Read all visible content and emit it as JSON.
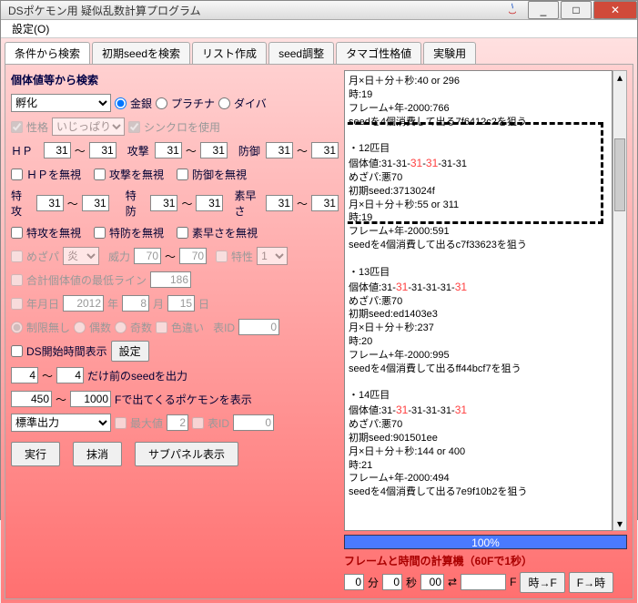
{
  "window": {
    "title": "DSポケモン用 疑似乱数計算プログラム"
  },
  "menu": {
    "settings": "設定(O)"
  },
  "tabs": [
    "条件から検索",
    "初期seedを検索",
    "リスト作成",
    "seed調整",
    "タマゴ性格値",
    "実験用"
  ],
  "active_tab": 0,
  "left": {
    "heading": "個体値等から検索",
    "method_select": "孵化",
    "version": {
      "gold": "金銀",
      "plat": "プラチナ",
      "dia": "ダイバ"
    },
    "nature_chk": "性格",
    "nature_val": "いじっぱり",
    "synchro": "シンクロを使用",
    "stats": {
      "hp": {
        "l": "ＨＰ",
        "a": "31",
        "b": "31"
      },
      "atk": {
        "l": "攻撃",
        "a": "31",
        "b": "31"
      },
      "def": {
        "l": "防御",
        "a": "31",
        "b": "31"
      },
      "spa": {
        "l": "特攻",
        "a": "31",
        "b": "31"
      },
      "spd": {
        "l": "特防",
        "a": "31",
        "b": "31"
      },
      "spe": {
        "l": "素早さ",
        "a": "31",
        "b": "31"
      }
    },
    "ignore": {
      "hp": "ＨＰを無視",
      "atk": "攻撃を無視",
      "def": "防御を無視",
      "spa": "特攻を無視",
      "spd": "特防を無視",
      "spe": "素早さを無視"
    },
    "hidden": {
      "l": "めざパ",
      "type": "炎",
      "power_l": "威力",
      "p1": "70",
      "p2": "70",
      "ability_l": "特性",
      "a": "1"
    },
    "total_min": {
      "l": "合計個体値の最低ライン",
      "v": "186"
    },
    "date": {
      "l": "年月日",
      "y": "2012",
      "yl": "年",
      "m": "8",
      "ml": "月",
      "d": "15",
      "dl": "日"
    },
    "limit": {
      "none": "制限無し",
      "even": "偶数",
      "odd": "奇数",
      "color": "色違い",
      "id_l": "表ID",
      "id": "0"
    },
    "ds_start": {
      "l": "DS開始時間表示",
      "btn": "設定"
    },
    "seed_before": {
      "a": "4",
      "b": "4",
      "l": "だけ前のseedを出力"
    },
    "frame_range": {
      "a": "450",
      "b": "1000",
      "l": "Fで出てくるポケモンを表示"
    },
    "output": "標準出力",
    "max": {
      "l": "最大値",
      "v": "2",
      "id_l": "表ID",
      "id": "0"
    },
    "buttons": {
      "run": "実行",
      "clear": "抹消",
      "sub": "サブパネル表示"
    }
  },
  "results_text": "月×日＋分＋秒:40 or 296\n時:19\nフレーム+年-2000:766\nseedを4個消費して出る7f6412c2を狙う\n\n・12匹目\n個体値:31-31-<hl>31</hl>-<hl>31</hl>-31-31\nめざパ:悪70\n初期seed:3713024f\n月×日＋分＋秒:55 or 311\n時:19\nフレーム+年-2000:591\nseedを4個消費して出るc7f33623を狙う\n\n・13匹目\n個体値:31-<hl>31</hl>-31-31-31-<hl>31</hl>\nめざパ:悪70\n初期seed:ed1403e3\n月×日＋分＋秒:237\n時:20\nフレーム+年-2000:995\nseedを4個消費して出るff44bcf7を狙う\n\n・14匹目\n個体値:31-<hl>31</hl>-31-31-31-<hl>31</hl>\nめざパ:悪70\n初期seed:901501ee\n月×日＋分＋秒:144 or 400\n時:21\nフレーム+年-2000:494\nseedを4個消費して出る7e9f10b2を狙う",
  "progress": "100%",
  "footer": {
    "title": "フレームと時間の計算機（60Fで1秒）",
    "min_l": "分",
    "sec_l": "秒",
    "f_l": "F",
    "min": "0",
    "sec": "0",
    "f": "00",
    "arrow": "⇄",
    "res": "",
    "btn_tf": "時→F",
    "btn_ft": "F→時"
  }
}
